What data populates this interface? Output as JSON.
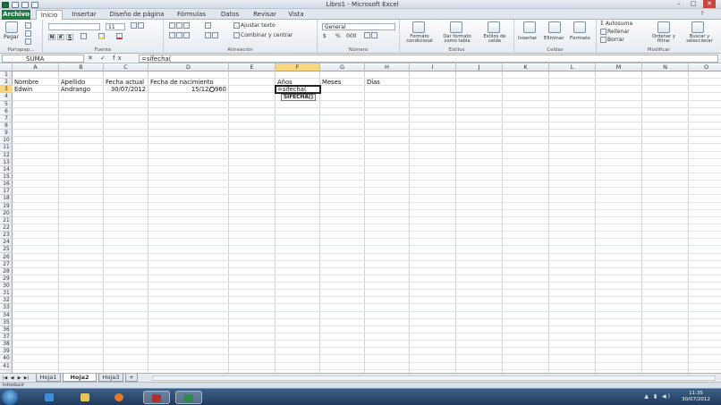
{
  "window": {
    "title": "Libro1  -  Microsoft Excel",
    "controls": [
      "–",
      "□",
      "✕"
    ]
  },
  "ribbon": {
    "tabs": [
      "Archivo",
      "Inicio",
      "Insertar",
      "Diseño de página",
      "Fórmulas",
      "Datos",
      "Revisar",
      "Vista"
    ],
    "clipboard": {
      "paste": "Pegar",
      "label": "Portapap..."
    },
    "font": {
      "name": "",
      "size": "11",
      "label": "Fuente",
      "bold": "N",
      "italic": "K",
      "underline": "S"
    },
    "alignment": {
      "wrap": "Ajustar texto",
      "merge": "Combinar y centrar",
      "label": "Alineación"
    },
    "number": {
      "format": "General",
      "percent": "%",
      "thousands": "000",
      "currency": "$",
      "label": "Número"
    },
    "styles": {
      "conditional": "Formato condicional",
      "table": "Dar formato como tabla",
      "cell": "Estilos de celda",
      "label": "Estilos"
    },
    "cells": {
      "insert": "Insertar",
      "delete": "Eliminar",
      "format": "Formato",
      "label": "Celdas"
    },
    "editing": {
      "autosum": "Autosuma",
      "fill": "Rellenar",
      "clear": "Borrar",
      "sort": "Ordenar y filtrar",
      "find": "Buscar y seleccionar",
      "label": "Modificar"
    }
  },
  "formula_bar": {
    "name_box": "SUMA",
    "icons": "✕ ✓ fx",
    "content": "=sifecha("
  },
  "grid": {
    "columns": [
      "A",
      "B",
      "C",
      "D",
      "E",
      "F",
      "G",
      "H",
      "I",
      "J",
      "K",
      "L",
      "M",
      "N",
      "O"
    ],
    "selected_column": "F",
    "selected_row": "3",
    "rows": [
      "1",
      "2",
      "3",
      "4",
      "5",
      "6",
      "7",
      "8",
      "9",
      "10",
      "11",
      "12",
      "13",
      "14",
      "15",
      "16",
      "17",
      "18",
      "19",
      "20",
      "21",
      "22",
      "23",
      "24",
      "25",
      "26",
      "27",
      "28",
      "29",
      "30",
      "31",
      "32",
      "33",
      "34",
      "35",
      "36",
      "37",
      "38",
      "39",
      "40",
      "41"
    ],
    "cells": {
      "A2": "Nombre",
      "B2": "Apellido",
      "C2": "Fecha actual",
      "D2": "Fecha de nacimiento",
      "F2": "Años",
      "G2": "Meses",
      "H2": "Días",
      "A3": "Edwin",
      "B3": "Andrango",
      "C3": "30/07/2012",
      "D3": "15/12/1960",
      "F3": "=sifecha("
    },
    "tooltip": "SIFECHA()"
  },
  "sheets": {
    "nav": [
      "|◀",
      "◀",
      "▶",
      "▶|"
    ],
    "tabs": [
      "Hoja1",
      "Hoja2",
      "Hoja3"
    ],
    "active": "Hoja2"
  },
  "status": {
    "mode": "Introducir"
  },
  "taskbar": {
    "time": "11:35",
    "date": "30/07/2012"
  }
}
